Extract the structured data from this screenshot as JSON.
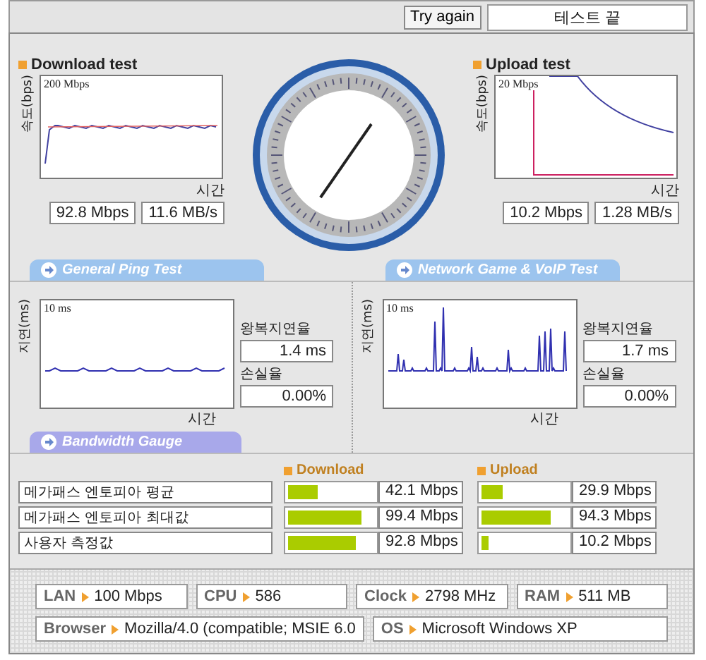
{
  "header": {
    "button": "Try again",
    "status": "테스트 끝"
  },
  "speed_tests": [
    {
      "kind": "download",
      "title": "Download test",
      "y_axis": "속도(bps)",
      "y_max": "200 Mbps",
      "x_axis": "시간",
      "readings": [
        "92.8 Mbps",
        "11.6 MB/s"
      ]
    },
    {
      "kind": "upload",
      "title": "Upload test",
      "y_axis": "속도(bps)",
      "y_max": "20 Mbps",
      "x_axis": "시간",
      "readings": [
        "10.2 Mbps",
        "1.28 MB/s"
      ]
    }
  ],
  "ping_tabs": [
    "General Ping Test",
    "Network Game & VoIP Test"
  ],
  "ping_tests": [
    {
      "kind": "flat",
      "y_axis": "지연(ms)",
      "y_max": "10 ms",
      "x_axis": "시간",
      "rtt_label": "왕복지연율",
      "rtt": "1.4 ms",
      "loss_label": "손실율",
      "loss": "0.00%"
    },
    {
      "kind": "spiky",
      "y_axis": "지연(ms)",
      "y_max": "10 ms",
      "x_axis": "시간",
      "rtt_label": "왕복지연율",
      "rtt": "1.7 ms",
      "loss_label": "손실율",
      "loss": "0.00%"
    }
  ],
  "bandwidth": {
    "tab": "Bandwidth Gauge",
    "columns": [
      "Download",
      "Upload"
    ],
    "rows": [
      {
        "label": "메가패스 엔토피아 평균",
        "download": {
          "level": 0.35,
          "value": "42.1 Mbps"
        },
        "upload": {
          "level": 0.25,
          "value": "29.9 Mbps"
        }
      },
      {
        "label": "메가패스 엔토피아 최대값",
        "download": {
          "level": 0.85,
          "value": "99.4 Mbps"
        },
        "upload": {
          "level": 0.8,
          "value": "94.3 Mbps"
        }
      },
      {
        "label": "사용자 측정값",
        "download": {
          "level": 0.78,
          "value": "92.8 Mbps"
        },
        "upload": {
          "level": 0.08,
          "value": "10.2 Mbps"
        }
      }
    ]
  },
  "system": [
    [
      {
        "label": "LAN",
        "value": "100 Mbps"
      },
      {
        "label": "CPU",
        "value": "586"
      },
      {
        "label": "Clock",
        "value": "2798 MHz"
      },
      {
        "label": "RAM",
        "value": "511 MB"
      }
    ],
    [
      {
        "label": "Browser",
        "value": "Mozilla/4.0 (compatible; MSIE 6.0"
      },
      {
        "label": "OS",
        "value": "Microsoft Windows XP"
      }
    ]
  ]
}
